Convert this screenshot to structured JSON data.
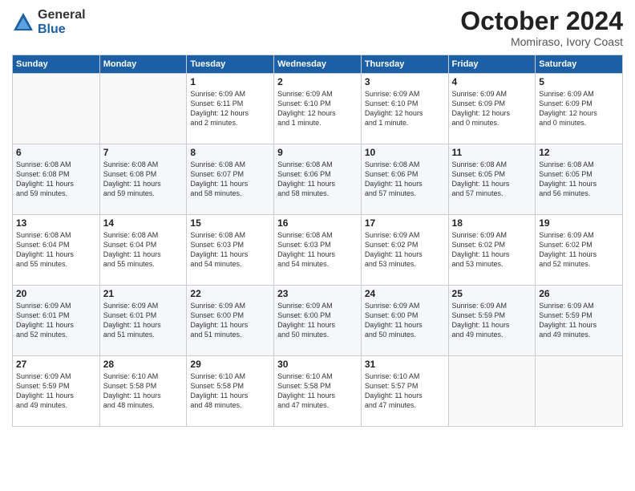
{
  "logo": {
    "general": "General",
    "blue": "Blue"
  },
  "title": "October 2024",
  "subtitle": "Momiraso, Ivory Coast",
  "days_header": [
    "Sunday",
    "Monday",
    "Tuesday",
    "Wednesday",
    "Thursday",
    "Friday",
    "Saturday"
  ],
  "weeks": [
    [
      {
        "day": "",
        "info": ""
      },
      {
        "day": "",
        "info": ""
      },
      {
        "day": "1",
        "info": "Sunrise: 6:09 AM\nSunset: 6:11 PM\nDaylight: 12 hours\nand 2 minutes."
      },
      {
        "day": "2",
        "info": "Sunrise: 6:09 AM\nSunset: 6:10 PM\nDaylight: 12 hours\nand 1 minute."
      },
      {
        "day": "3",
        "info": "Sunrise: 6:09 AM\nSunset: 6:10 PM\nDaylight: 12 hours\nand 1 minute."
      },
      {
        "day": "4",
        "info": "Sunrise: 6:09 AM\nSunset: 6:09 PM\nDaylight: 12 hours\nand 0 minutes."
      },
      {
        "day": "5",
        "info": "Sunrise: 6:09 AM\nSunset: 6:09 PM\nDaylight: 12 hours\nand 0 minutes."
      }
    ],
    [
      {
        "day": "6",
        "info": "Sunrise: 6:08 AM\nSunset: 6:08 PM\nDaylight: 11 hours\nand 59 minutes."
      },
      {
        "day": "7",
        "info": "Sunrise: 6:08 AM\nSunset: 6:08 PM\nDaylight: 11 hours\nand 59 minutes."
      },
      {
        "day": "8",
        "info": "Sunrise: 6:08 AM\nSunset: 6:07 PM\nDaylight: 11 hours\nand 58 minutes."
      },
      {
        "day": "9",
        "info": "Sunrise: 6:08 AM\nSunset: 6:06 PM\nDaylight: 11 hours\nand 58 minutes."
      },
      {
        "day": "10",
        "info": "Sunrise: 6:08 AM\nSunset: 6:06 PM\nDaylight: 11 hours\nand 57 minutes."
      },
      {
        "day": "11",
        "info": "Sunrise: 6:08 AM\nSunset: 6:05 PM\nDaylight: 11 hours\nand 57 minutes."
      },
      {
        "day": "12",
        "info": "Sunrise: 6:08 AM\nSunset: 6:05 PM\nDaylight: 11 hours\nand 56 minutes."
      }
    ],
    [
      {
        "day": "13",
        "info": "Sunrise: 6:08 AM\nSunset: 6:04 PM\nDaylight: 11 hours\nand 55 minutes."
      },
      {
        "day": "14",
        "info": "Sunrise: 6:08 AM\nSunset: 6:04 PM\nDaylight: 11 hours\nand 55 minutes."
      },
      {
        "day": "15",
        "info": "Sunrise: 6:08 AM\nSunset: 6:03 PM\nDaylight: 11 hours\nand 54 minutes."
      },
      {
        "day": "16",
        "info": "Sunrise: 6:08 AM\nSunset: 6:03 PM\nDaylight: 11 hours\nand 54 minutes."
      },
      {
        "day": "17",
        "info": "Sunrise: 6:09 AM\nSunset: 6:02 PM\nDaylight: 11 hours\nand 53 minutes."
      },
      {
        "day": "18",
        "info": "Sunrise: 6:09 AM\nSunset: 6:02 PM\nDaylight: 11 hours\nand 53 minutes."
      },
      {
        "day": "19",
        "info": "Sunrise: 6:09 AM\nSunset: 6:02 PM\nDaylight: 11 hours\nand 52 minutes."
      }
    ],
    [
      {
        "day": "20",
        "info": "Sunrise: 6:09 AM\nSunset: 6:01 PM\nDaylight: 11 hours\nand 52 minutes."
      },
      {
        "day": "21",
        "info": "Sunrise: 6:09 AM\nSunset: 6:01 PM\nDaylight: 11 hours\nand 51 minutes."
      },
      {
        "day": "22",
        "info": "Sunrise: 6:09 AM\nSunset: 6:00 PM\nDaylight: 11 hours\nand 51 minutes."
      },
      {
        "day": "23",
        "info": "Sunrise: 6:09 AM\nSunset: 6:00 PM\nDaylight: 11 hours\nand 50 minutes."
      },
      {
        "day": "24",
        "info": "Sunrise: 6:09 AM\nSunset: 6:00 PM\nDaylight: 11 hours\nand 50 minutes."
      },
      {
        "day": "25",
        "info": "Sunrise: 6:09 AM\nSunset: 5:59 PM\nDaylight: 11 hours\nand 49 minutes."
      },
      {
        "day": "26",
        "info": "Sunrise: 6:09 AM\nSunset: 5:59 PM\nDaylight: 11 hours\nand 49 minutes."
      }
    ],
    [
      {
        "day": "27",
        "info": "Sunrise: 6:09 AM\nSunset: 5:59 PM\nDaylight: 11 hours\nand 49 minutes."
      },
      {
        "day": "28",
        "info": "Sunrise: 6:10 AM\nSunset: 5:58 PM\nDaylight: 11 hours\nand 48 minutes."
      },
      {
        "day": "29",
        "info": "Sunrise: 6:10 AM\nSunset: 5:58 PM\nDaylight: 11 hours\nand 48 minutes."
      },
      {
        "day": "30",
        "info": "Sunrise: 6:10 AM\nSunset: 5:58 PM\nDaylight: 11 hours\nand 47 minutes."
      },
      {
        "day": "31",
        "info": "Sunrise: 6:10 AM\nSunset: 5:57 PM\nDaylight: 11 hours\nand 47 minutes."
      },
      {
        "day": "",
        "info": ""
      },
      {
        "day": "",
        "info": ""
      }
    ]
  ]
}
